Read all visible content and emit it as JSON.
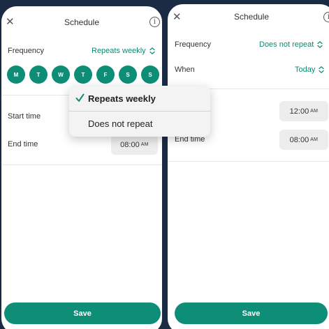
{
  "left_screen": {
    "title": "Schedule",
    "close_icon": "close-icon",
    "info_icon": "info-icon",
    "frequency": {
      "label": "Frequency",
      "value": "Repeats weekly"
    },
    "days": [
      "M",
      "T",
      "W",
      "T",
      "F",
      "S",
      "S"
    ],
    "start_time": {
      "label": "Start time"
    },
    "end_time": {
      "label": "End time",
      "time": "08:00",
      "ampm": "AM"
    },
    "save_label": "Save"
  },
  "popup": {
    "selected_index": 0,
    "options": [
      "Repeats weekly",
      "Does not repeat"
    ]
  },
  "right_screen": {
    "title": "Schedule",
    "close_icon": "close-icon",
    "info_icon": "info-icon",
    "frequency": {
      "label": "Frequency",
      "value": "Does not repeat"
    },
    "when": {
      "label": "When",
      "value": "Today"
    },
    "start_time": {
      "time": "12:00",
      "ampm": "AM"
    },
    "end_time": {
      "label": "End time",
      "time": "08:00",
      "ampm": "AM"
    },
    "save_label": "Save"
  },
  "colors": {
    "accent": "#0e8e77",
    "accent_text": "#0b8a73",
    "background": "#1c2b44"
  }
}
